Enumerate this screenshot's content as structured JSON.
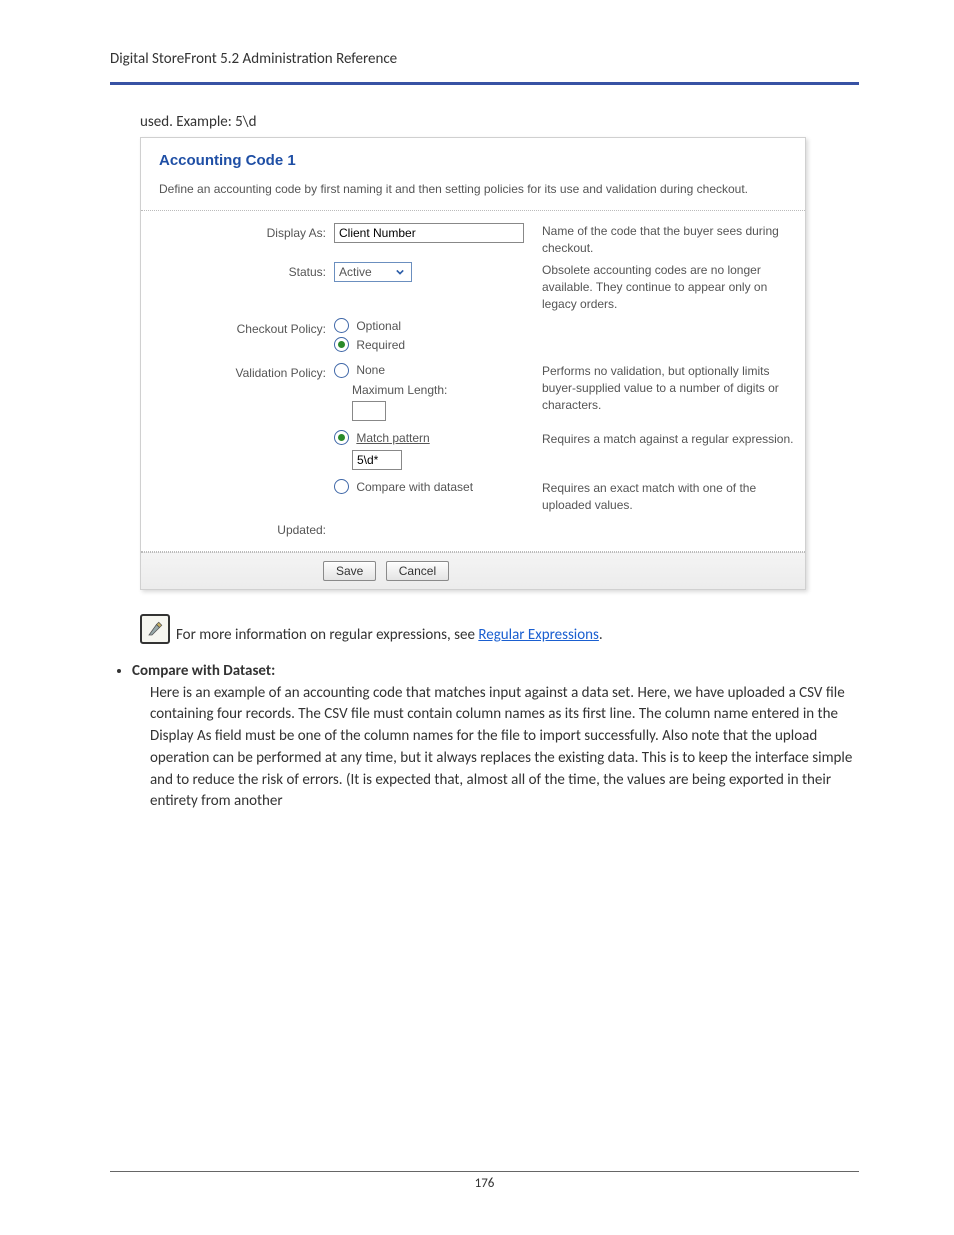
{
  "header": {
    "title": "Digital StoreFront 5.2 Administration Reference"
  },
  "intro_line": "used. Example: 5\\d",
  "panel": {
    "title": "Accounting Code 1",
    "description": "Define an accounting code by first naming it and then setting policies for its use and validation during checkout.",
    "labels": {
      "display_as": "Display As:",
      "status": "Status:",
      "checkout_policy": "Checkout Policy:",
      "validation_policy": "Validation Policy:",
      "updated": "Updated:"
    },
    "values": {
      "display_as": "Client Number",
      "status_selected": "Active",
      "pattern_value": "5\\d*",
      "max_length_value": ""
    },
    "checkout_options": {
      "optional": "Optional",
      "required": "Required",
      "selected": "required"
    },
    "validation_options": {
      "none": "None",
      "none_sublabel": "Maximum Length:",
      "match_pattern": "Match pattern",
      "compare_dataset": "Compare with dataset",
      "selected": "match_pattern"
    },
    "help": {
      "display_as": "Name of the code that the buyer sees during checkout.",
      "status": "Obsolete accounting codes are no longer available. They continue to appear only on legacy orders.",
      "none": "Performs no validation, but optionally limits buyer-supplied value to a number of digits or characters.",
      "match_pattern": "Requires a match against a regular expression.",
      "compare_dataset": "Requires an exact match with one of the uploaded values."
    },
    "buttons": {
      "save": "Save",
      "cancel": "Cancel"
    }
  },
  "note": {
    "prefix": "For more information on regular expressions, see ",
    "link_text": "Regular Expressions",
    "suffix": "."
  },
  "bullet": {
    "heading": "Compare with Dataset:",
    "body": "Here is an example of an accounting code that matches input against a data set. Here, we have uploaded a CSV file containing four records. The CSV file must contain column names as its first line. The column name entered in the Display As field must be one of the column names for the file to import successfully. Also note that the upload operation can be performed at any time, but it always replaces the existing data. This is to keep the interface simple and to reduce the risk of errors. (It is expected that, almost all of the time, the values are being exported in their entirety from another"
  },
  "footer": {
    "page_number": "176"
  }
}
